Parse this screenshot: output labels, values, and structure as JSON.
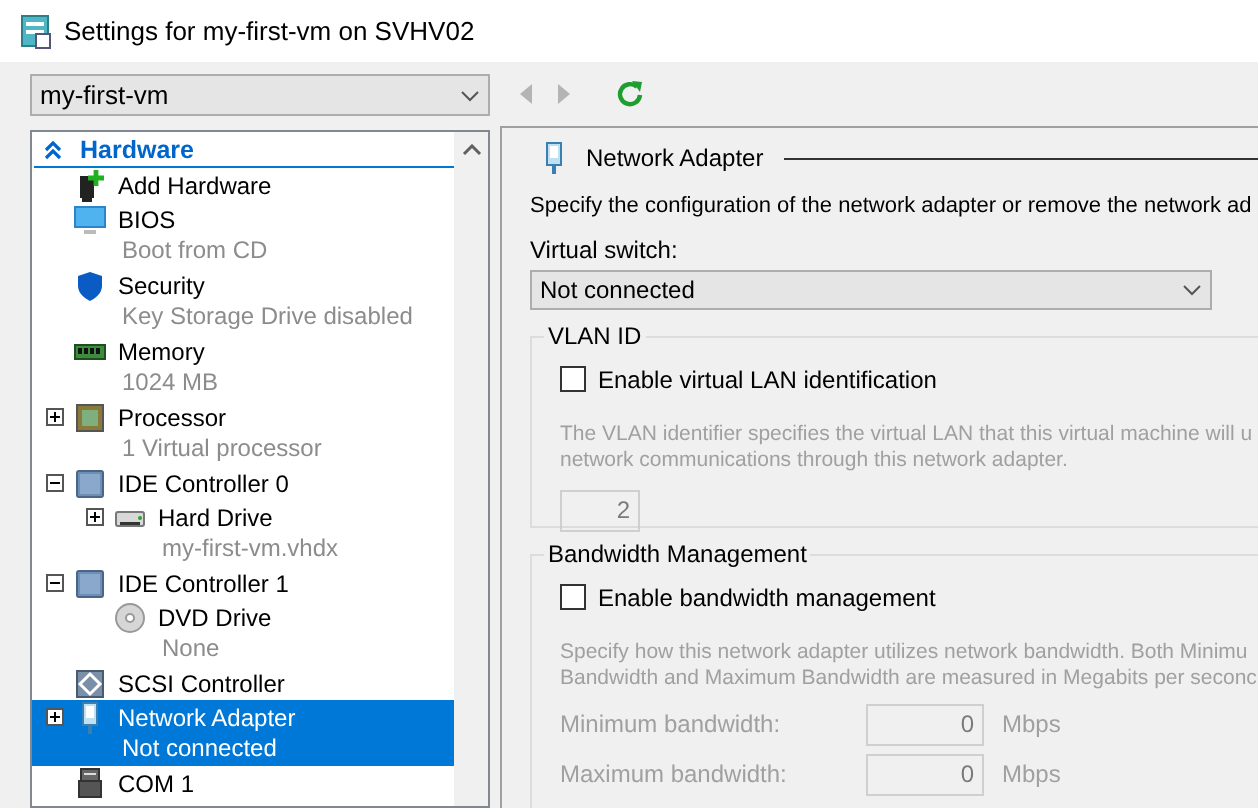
{
  "window": {
    "title": "Settings for my-first-vm on SVHV02"
  },
  "vm_selector": {
    "value": "my-first-vm"
  },
  "toolbar": [
    {
      "kind": "back",
      "disabled": true
    },
    {
      "kind": "forward",
      "disabled": true
    },
    {
      "kind": "refresh",
      "disabled": false
    }
  ],
  "tree": {
    "section": "Hardware",
    "items": [
      {
        "kind": "add",
        "name": "Add Hardware",
        "selected": false
      },
      {
        "kind": "bios",
        "name": "BIOS",
        "detail": "Boot from CD",
        "selected": false
      },
      {
        "kind": "security",
        "name": "Security",
        "detail": "Key Storage Drive disabled",
        "selected": false
      },
      {
        "kind": "memory",
        "name": "Memory",
        "detail": "1024 MB",
        "selected": false
      },
      {
        "kind": "processor",
        "name": "Processor",
        "detail": "1 Virtual processor",
        "expanded": false,
        "selected": false
      },
      {
        "kind": "controller",
        "name": "IDE Controller 0",
        "expanded": true,
        "selected": false,
        "children": [
          {
            "kind": "disk",
            "name": "Hard Drive",
            "detail": "my-first-vm.vhdx",
            "expanded": false,
            "selected": false
          }
        ]
      },
      {
        "kind": "controller",
        "name": "IDE Controller 1",
        "expanded": true,
        "selected": false,
        "children": [
          {
            "kind": "dvd",
            "name": "DVD Drive",
            "detail": "None",
            "selected": false
          }
        ]
      },
      {
        "kind": "scsi",
        "name": "SCSI Controller",
        "selected": false
      },
      {
        "kind": "network",
        "name": "Network Adapter",
        "detail": "Not connected",
        "expanded": false,
        "selected": true
      },
      {
        "kind": "com",
        "name": "COM 1",
        "selected": false
      }
    ]
  },
  "panel": {
    "title": "Network Adapter",
    "description": "Specify the configuration of the network adapter or remove the network ad",
    "virtual_switch": {
      "label": "Virtual switch:",
      "value": "Not connected"
    },
    "vlan": {
      "legend": "VLAN ID",
      "checkbox": {
        "label": "Enable virtual LAN identification",
        "checked": false
      },
      "help": [
        "The VLAN identifier specifies the virtual LAN that this virtual machine will u",
        "network communications through this network adapter."
      ],
      "value": "2"
    },
    "bandwidth": {
      "legend": "Bandwidth Management",
      "checkbox": {
        "label": "Enable bandwidth management",
        "checked": false
      },
      "help": [
        "Specify how this network adapter utilizes network bandwidth. Both Minimu",
        "Bandwidth and Maximum Bandwidth are measured in Megabits per seconc"
      ],
      "fields": [
        {
          "label": "Minimum bandwidth:",
          "value": "0",
          "unit": "Mbps"
        },
        {
          "label": "Maximum bandwidth:",
          "value": "0",
          "unit": "Mbps"
        }
      ]
    }
  }
}
